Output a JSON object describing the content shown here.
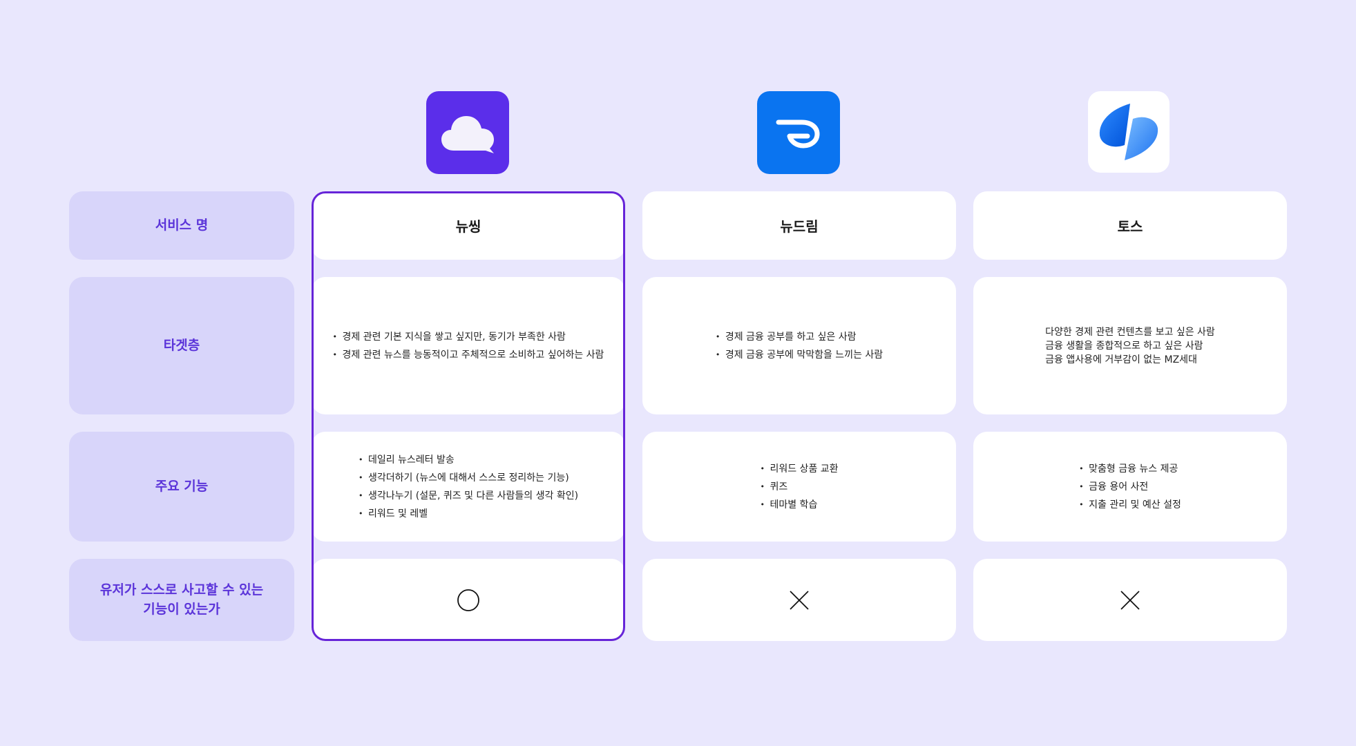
{
  "colors": {
    "background": "#E9E7FD",
    "label_bg": "#D8D5FA",
    "label_text": "#5B34D9",
    "highlight_border": "#6624D8",
    "logo_newthink": "#5B2EEA",
    "logo_newdream": "#0A74F0"
  },
  "row_labels": {
    "service": "서비스 명",
    "target": "타겟층",
    "features": "주요 기능",
    "self_thinking_line1": "유저가 스스로 사고할 수 있는",
    "self_thinking_line2": "기능이 있는가"
  },
  "services": [
    {
      "name": "뉴씽",
      "logo_icon": "cloud-speech-icon",
      "target": [
        "경제 관련 기본 지식을 쌓고 싶지만, 동기가 부족한 사람",
        "경제 관련 뉴스를 능동적이고 주체적으로 소비하고 싶어하는 사람"
      ],
      "features": [
        "데일리 뉴스레터 발송",
        "생각더하기 (뉴스에 대해서 스스로 정리하는 기능)",
        "생각나누기 (설문, 퀴즈 및 다른 사람들의 생각 확인)",
        "리워드 및 레벨"
      ],
      "self_thinking": "circle"
    },
    {
      "name": "뉴드림",
      "logo_icon": "wing-icon",
      "target": [
        "경제 금융 공부를 하고 싶은 사람",
        "경제 금융 공부에 막막함을 느끼는 사람"
      ],
      "features": [
        "리워드 상품 교환",
        "퀴즈",
        "테마별 학습"
      ],
      "self_thinking": "cross"
    },
    {
      "name": "토스",
      "logo_icon": "toss-logo-icon",
      "target": [
        "다양한 경제 관련 컨텐츠를 보고 싶은 사람",
        "금융 생활을 종합적으로 하고 싶은 사람",
        "금융 앱사용에 거부감이 없는 MZ세대"
      ],
      "features": [
        "맞춤형 금융 뉴스 제공",
        "금융 용어 사전",
        "지출 관리 및 예산 설정"
      ],
      "self_thinking": "cross"
    }
  ]
}
